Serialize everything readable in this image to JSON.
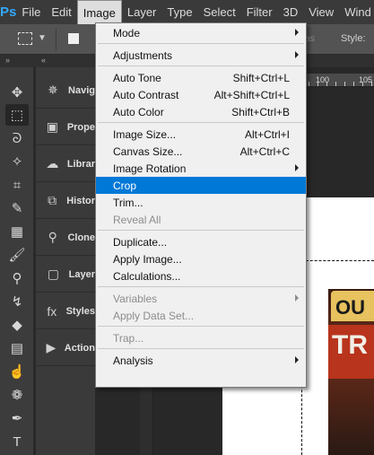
{
  "app": {
    "logo": "Ps"
  },
  "menubar": {
    "items": [
      {
        "label": "File",
        "active": false
      },
      {
        "label": "Edit",
        "active": false
      },
      {
        "label": "Image",
        "active": true
      },
      {
        "label": "Layer",
        "active": false
      },
      {
        "label": "Type",
        "active": false
      },
      {
        "label": "Select",
        "active": false
      },
      {
        "label": "Filter",
        "active": false
      },
      {
        "label": "3D",
        "active": false
      },
      {
        "label": "View",
        "active": false
      },
      {
        "label": "Wind",
        "active": false
      }
    ]
  },
  "options_bar": {
    "alias_text": "ias",
    "style_label": "Style:"
  },
  "toolbar": {
    "tools": [
      {
        "name": "move-tool-icon",
        "glyph": "✥",
        "selected": false
      },
      {
        "name": "rectangular-marquee-tool-icon",
        "glyph": "⬚",
        "selected": true
      },
      {
        "name": "lasso-tool-icon",
        "glyph": "ᘐ",
        "selected": false
      },
      {
        "name": "magic-wand-tool-icon",
        "glyph": "✧",
        "selected": false
      },
      {
        "name": "crop-tool-icon",
        "glyph": "⌗",
        "selected": false
      },
      {
        "name": "eyedropper-tool-icon",
        "glyph": "✎",
        "selected": false
      },
      {
        "name": "healing-brush-tool-icon",
        "glyph": "▦",
        "selected": false
      },
      {
        "name": "brush-tool-icon",
        "glyph": "🖌",
        "selected": false
      },
      {
        "name": "clone-stamp-tool-icon",
        "glyph": "⚲",
        "selected": false
      },
      {
        "name": "history-brush-tool-icon",
        "glyph": "↯",
        "selected": false
      },
      {
        "name": "eraser-tool-icon",
        "glyph": "◆",
        "selected": false
      },
      {
        "name": "gradient-tool-icon",
        "glyph": "▤",
        "selected": false
      },
      {
        "name": "smudge-tool-icon",
        "glyph": "☝",
        "selected": false
      },
      {
        "name": "sponge-tool-icon",
        "glyph": "❁",
        "selected": false
      },
      {
        "name": "pen-tool-icon",
        "glyph": "✒",
        "selected": false
      },
      {
        "name": "type-tool-icon",
        "glyph": "T",
        "selected": false
      }
    ]
  },
  "dock": {
    "panels": [
      {
        "name": "navigator",
        "icon": "navigator-icon",
        "glyph": "✵",
        "label": "Navig"
      },
      {
        "name": "properties",
        "icon": "properties-icon",
        "glyph": "▣",
        "label": "Prope"
      },
      {
        "name": "libraries",
        "icon": "libraries-icon",
        "glyph": "☁",
        "label": "Librar"
      },
      {
        "name": "history",
        "icon": "history-icon",
        "glyph": "⧉",
        "label": "Histor"
      },
      {
        "name": "clone-source",
        "icon": "clone-source-icon",
        "glyph": "⚲",
        "label": "Clone"
      },
      {
        "name": "layer-comps",
        "icon": "layer-comps-icon",
        "glyph": "▢",
        "label": "Layer"
      },
      {
        "name": "styles",
        "icon": "styles-icon",
        "glyph": "fx",
        "label": "Styles"
      },
      {
        "name": "actions",
        "icon": "actions-icon",
        "glyph": "▶",
        "label": "Action"
      }
    ]
  },
  "ruler": {
    "labels": [
      "100",
      "105"
    ]
  },
  "canvas": {
    "photo_text_line1": "OU",
    "photo_text_line2": "TR"
  },
  "image_menu": {
    "items": [
      {
        "type": "item",
        "label": "Mode",
        "shortcut": "",
        "submenu": true,
        "disabled": false,
        "highlighted": false
      },
      {
        "type": "sep"
      },
      {
        "type": "item",
        "label": "Adjustments",
        "shortcut": "",
        "submenu": true,
        "disabled": false,
        "highlighted": false
      },
      {
        "type": "sep"
      },
      {
        "type": "item",
        "label": "Auto Tone",
        "shortcut": "Shift+Ctrl+L",
        "submenu": false,
        "disabled": false,
        "highlighted": false
      },
      {
        "type": "item",
        "label": "Auto Contrast",
        "shortcut": "Alt+Shift+Ctrl+L",
        "submenu": false,
        "disabled": false,
        "highlighted": false
      },
      {
        "type": "item",
        "label": "Auto Color",
        "shortcut": "Shift+Ctrl+B",
        "submenu": false,
        "disabled": false,
        "highlighted": false
      },
      {
        "type": "sep"
      },
      {
        "type": "item",
        "label": "Image Size...",
        "shortcut": "Alt+Ctrl+I",
        "submenu": false,
        "disabled": false,
        "highlighted": false
      },
      {
        "type": "item",
        "label": "Canvas Size...",
        "shortcut": "Alt+Ctrl+C",
        "submenu": false,
        "disabled": false,
        "highlighted": false
      },
      {
        "type": "item",
        "label": "Image Rotation",
        "shortcut": "",
        "submenu": true,
        "disabled": false,
        "highlighted": false
      },
      {
        "type": "item",
        "label": "Crop",
        "shortcut": "",
        "submenu": false,
        "disabled": false,
        "highlighted": true
      },
      {
        "type": "item",
        "label": "Trim...",
        "shortcut": "",
        "submenu": false,
        "disabled": false,
        "highlighted": false
      },
      {
        "type": "item",
        "label": "Reveal All",
        "shortcut": "",
        "submenu": false,
        "disabled": true,
        "highlighted": false
      },
      {
        "type": "sep"
      },
      {
        "type": "item",
        "label": "Duplicate...",
        "shortcut": "",
        "submenu": false,
        "disabled": false,
        "highlighted": false
      },
      {
        "type": "item",
        "label": "Apply Image...",
        "shortcut": "",
        "submenu": false,
        "disabled": false,
        "highlighted": false
      },
      {
        "type": "item",
        "label": "Calculations...",
        "shortcut": "",
        "submenu": false,
        "disabled": false,
        "highlighted": false
      },
      {
        "type": "sep"
      },
      {
        "type": "item",
        "label": "Variables",
        "shortcut": "",
        "submenu": true,
        "disabled": true,
        "highlighted": false
      },
      {
        "type": "item",
        "label": "Apply Data Set...",
        "shortcut": "",
        "submenu": false,
        "disabled": true,
        "highlighted": false
      },
      {
        "type": "sep"
      },
      {
        "type": "item",
        "label": "Trap...",
        "shortcut": "",
        "submenu": false,
        "disabled": true,
        "highlighted": false
      },
      {
        "type": "sep"
      },
      {
        "type": "item",
        "label": "Analysis",
        "shortcut": "",
        "submenu": true,
        "disabled": false,
        "highlighted": false
      }
    ]
  }
}
